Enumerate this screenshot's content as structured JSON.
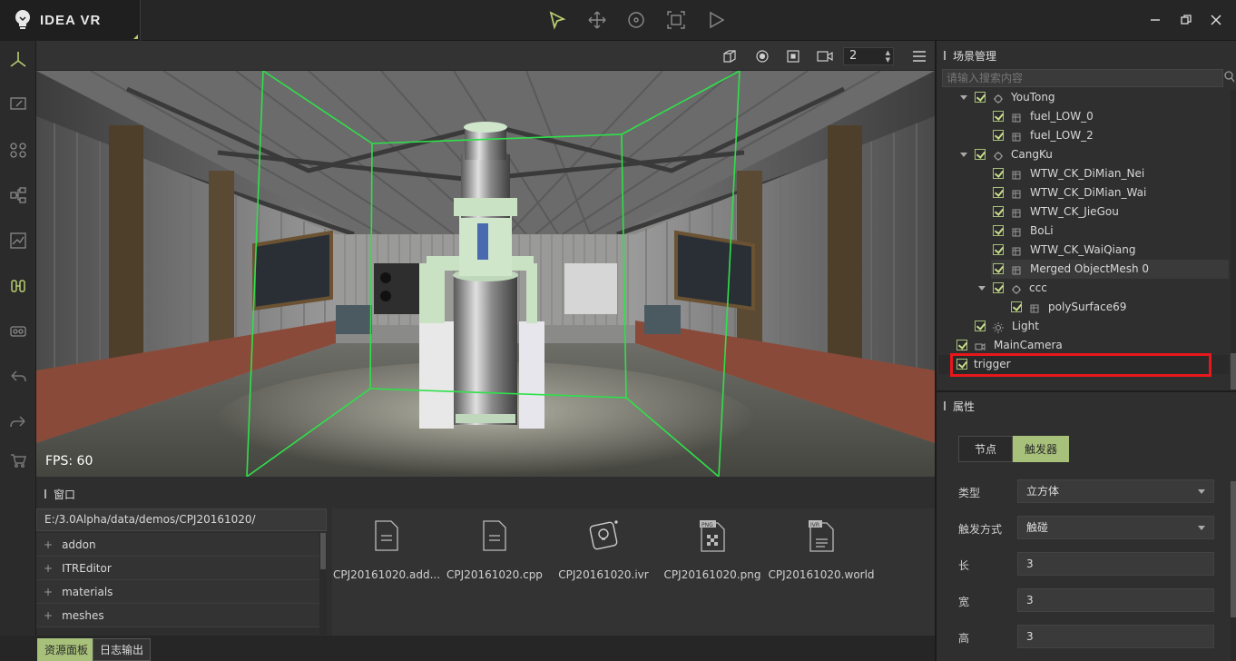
{
  "app": {
    "name": "IDEA VR"
  },
  "colors": {
    "accent": "#a7c07a",
    "highlight_box": "#e8171c",
    "bounding_box": "#2fe04a"
  },
  "main_toolbar": {
    "tools": [
      "select-icon",
      "move-icon",
      "rotate-icon",
      "scale-icon",
      "play-icon"
    ]
  },
  "window_controls": [
    "minimize-icon",
    "restore-icon",
    "close-icon"
  ],
  "left_tools": [
    "axis-icon",
    "edit-icon",
    "nodes-icon",
    "hierarchy-icon",
    "chart-icon",
    "vr-device-icon",
    "vr-glasses-icon",
    "undo-icon",
    "redo-icon",
    "cart-icon"
  ],
  "viewport": {
    "toolbar_icons": [
      "cube-view-icon",
      "camera-target-icon",
      "frame-icon",
      "video-camera-icon",
      "menu-icon"
    ],
    "camera_number": "2",
    "fps_label": "FPS: 60"
  },
  "resource_window": {
    "title": "窗口",
    "path": "E:/3.0Alpha/data/demos/CPJ20161020/",
    "folders": [
      "addon",
      "ITREditor",
      "materials",
      "meshes"
    ],
    "files": [
      {
        "name": "CPJ20161020.add...",
        "icon": "document-icon"
      },
      {
        "name": "CPJ20161020.cpp",
        "icon": "document-icon"
      },
      {
        "name": "CPJ20161020.ivr",
        "icon": "ivr-file-icon"
      },
      {
        "name": "CPJ20161020.png",
        "icon": "png-file-icon"
      },
      {
        "name": "CPJ20161020.world",
        "icon": "world-file-icon"
      }
    ]
  },
  "bottom_tabs": [
    "资源面板",
    "日志输出"
  ],
  "scene_panel": {
    "title": "场景管理",
    "search_placeholder": "请输入搜索内容",
    "tree": [
      {
        "label": "YouTong",
        "type": "group"
      },
      {
        "label": "fuel_LOW_0",
        "type": "mesh"
      },
      {
        "label": "fuel_LOW_2",
        "type": "mesh"
      },
      {
        "label": "CangKu",
        "type": "group"
      },
      {
        "label": "WTW_CK_DiMian_Nei",
        "type": "mesh"
      },
      {
        "label": "WTW_CK_DiMian_Wai",
        "type": "mesh"
      },
      {
        "label": "WTW_CK_JieGou",
        "type": "mesh"
      },
      {
        "label": "BoLi",
        "type": "mesh"
      },
      {
        "label": "WTW_CK_WaiQiang",
        "type": "mesh"
      },
      {
        "label": "Merged ObjectMesh 0",
        "type": "mesh"
      },
      {
        "label": "ccc",
        "type": "group"
      },
      {
        "label": "polySurface69",
        "type": "mesh"
      },
      {
        "label": "Light",
        "type": "light"
      },
      {
        "label": "MainCamera",
        "type": "camera"
      },
      {
        "label": "trigger",
        "type": "trigger"
      }
    ]
  },
  "properties": {
    "title": "属性",
    "tabs": [
      "节点",
      "触发器"
    ],
    "active_tab": "触发器",
    "fields": [
      {
        "label": "类型",
        "value": "立方体",
        "dropdown": true
      },
      {
        "label": "触发方式",
        "value": "触碰",
        "dropdown": true
      },
      {
        "label": "长",
        "value": "3"
      },
      {
        "label": "宽",
        "value": "3"
      },
      {
        "label": "高",
        "value": "3"
      }
    ]
  }
}
